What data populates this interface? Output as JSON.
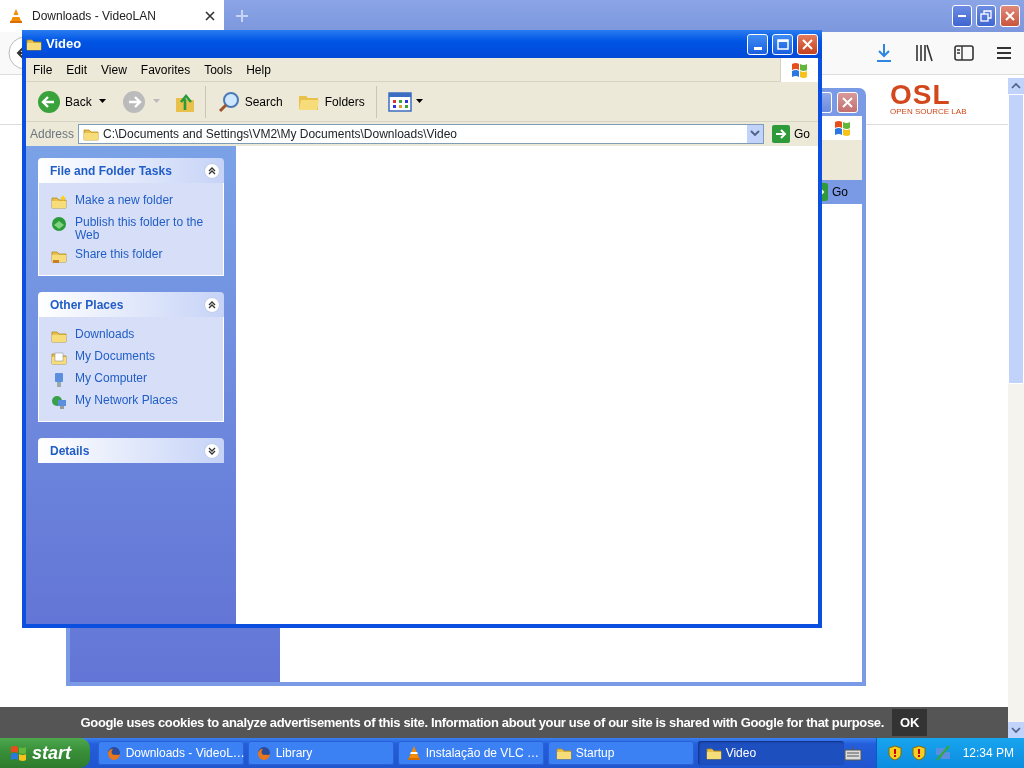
{
  "browser": {
    "tabs": [
      {
        "title": "Downloads - VideoLAN",
        "selected": true
      }
    ],
    "page": {
      "logo": "OSL",
      "logo_tagline": "OPEN SOURCE LAB"
    },
    "cookie_notice": {
      "text": "Google uses cookies to analyze advertisements of this site. Information about your use of our site is shared with Google for that purpose.",
      "button": "OK"
    }
  },
  "background_window": {
    "go_label": "Go"
  },
  "explorer": {
    "title": "Video",
    "menu": [
      "File",
      "Edit",
      "View",
      "Favorites",
      "Tools",
      "Help"
    ],
    "toolbar": {
      "back": "Back",
      "forward_disabled": true,
      "search": "Search",
      "folders": "Folders"
    },
    "address": {
      "label": "Address",
      "path": "C:\\Documents and Settings\\VM2\\My Documents\\Downloads\\Video",
      "go": "Go"
    },
    "panels": [
      {
        "title": "File and Folder Tasks",
        "expanded": true,
        "items": [
          {
            "label": "Make a new folder",
            "kind": "new-folder"
          },
          {
            "label": "Publish this folder to the Web",
            "kind": "publish"
          },
          {
            "label": "Share this folder",
            "kind": "share"
          }
        ]
      },
      {
        "title": "Other Places",
        "expanded": true,
        "items": [
          {
            "label": "Downloads",
            "kind": "folder"
          },
          {
            "label": "My Documents",
            "kind": "documents"
          },
          {
            "label": "My Computer",
            "kind": "computer"
          },
          {
            "label": "My Network Places",
            "kind": "network"
          }
        ]
      },
      {
        "title": "Details",
        "expanded": false
      }
    ]
  },
  "taskbar": {
    "start": "start",
    "tasks": [
      {
        "label": "Downloads - VideoL…",
        "kind": "firefox",
        "selected": false
      },
      {
        "label": "Library",
        "kind": "firefox",
        "selected": false
      },
      {
        "label": "Instalação de VLC …",
        "kind": "vlc",
        "selected": false
      },
      {
        "label": "Startup",
        "kind": "folder",
        "selected": false
      },
      {
        "label": "Video",
        "kind": "folder",
        "selected": true
      }
    ],
    "clock": "12:34 PM"
  }
}
